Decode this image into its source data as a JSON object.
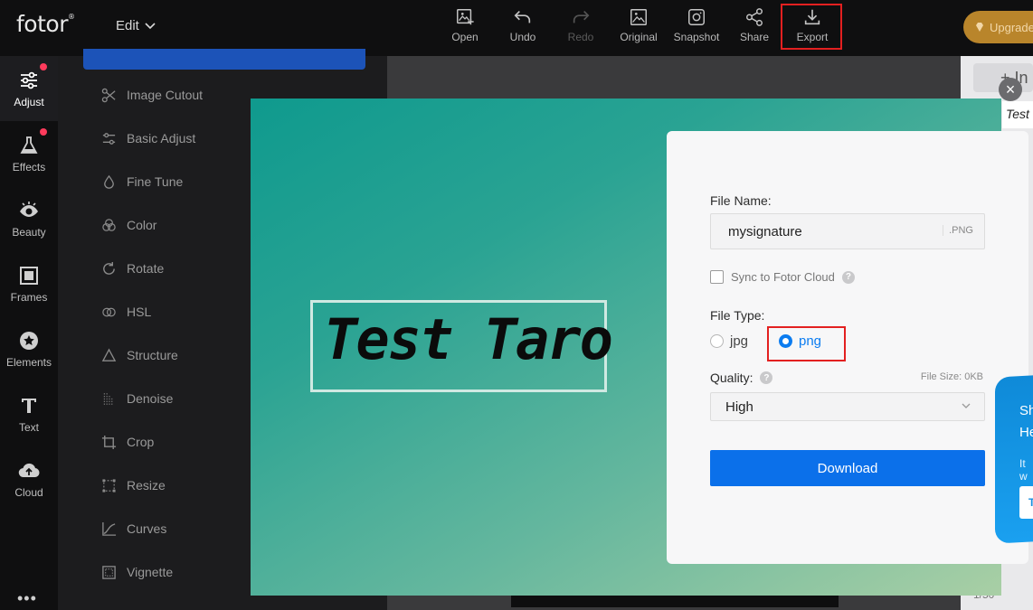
{
  "app": {
    "logo": "fotor",
    "logo_mark": "®",
    "edit_menu": "Edit",
    "upgrade": "Upgrade"
  },
  "toolbar": [
    {
      "name": "open",
      "label": "Open",
      "icon": "image-plus-icon",
      "enabled": true
    },
    {
      "name": "undo",
      "label": "Undo",
      "icon": "undo-icon",
      "enabled": true
    },
    {
      "name": "redo",
      "label": "Redo",
      "icon": "redo-icon",
      "enabled": false
    },
    {
      "name": "original",
      "label": "Original",
      "icon": "image-icon",
      "enabled": true
    },
    {
      "name": "snapshot",
      "label": "Snapshot",
      "icon": "camera-icon",
      "enabled": true
    },
    {
      "name": "share",
      "label": "Share",
      "icon": "share-icon",
      "enabled": true
    },
    {
      "name": "export",
      "label": "Export",
      "icon": "download-icon",
      "enabled": true,
      "highlighted": true
    }
  ],
  "rail": [
    {
      "label": "Adjust",
      "icon": "sliders-icon",
      "active": true,
      "badge": true
    },
    {
      "label": "Effects",
      "icon": "flask-icon",
      "active": false,
      "badge": true
    },
    {
      "label": "Beauty",
      "icon": "eye-icon",
      "active": false,
      "badge": false
    },
    {
      "label": "Frames",
      "icon": "frame-icon",
      "active": false,
      "badge": false
    },
    {
      "label": "Elements",
      "icon": "star-icon",
      "active": false,
      "badge": false
    },
    {
      "label": "Text",
      "icon": "text-icon",
      "active": false,
      "badge": false
    },
    {
      "label": "Cloud",
      "icon": "cloud-upload-icon",
      "active": false,
      "badge": false
    }
  ],
  "rail_more": "•••",
  "panel_items": [
    {
      "label": "Image Cutout",
      "icon": "scissors-icon"
    },
    {
      "label": "Basic Adjust",
      "icon": "sliders-icon"
    },
    {
      "label": "Fine Tune",
      "icon": "droplet-icon"
    },
    {
      "label": "Color",
      "icon": "color-circles-icon"
    },
    {
      "label": "Rotate",
      "icon": "rotate-icon"
    },
    {
      "label": "HSL",
      "icon": "hsl-icon"
    },
    {
      "label": "Structure",
      "icon": "triangle-icon"
    },
    {
      "label": "Denoise",
      "icon": "denoise-icon"
    },
    {
      "label": "Crop",
      "icon": "crop-icon"
    },
    {
      "label": "Resize",
      "icon": "resize-icon"
    },
    {
      "label": "Curves",
      "icon": "curves-icon"
    },
    {
      "label": "Vignette",
      "icon": "vignette-icon"
    }
  ],
  "strip": {
    "add_label": "+ In",
    "thumb_text": "Test",
    "page_count": "1/50"
  },
  "modal": {
    "preview_text": "Test Taro",
    "file_name_label": "File Name:",
    "file_name_value": "mysignature",
    "file_ext": ".PNG",
    "sync_label": "Sync to Fotor Cloud",
    "sync_checked": false,
    "file_type_label": "File Type:",
    "file_types": [
      {
        "label": "jpg",
        "selected": false
      },
      {
        "label": "png",
        "selected": true
      }
    ],
    "quality_label": "Quality:",
    "file_size": "File Size: 0KB",
    "quality_value": "High",
    "download_label": "Download"
  },
  "promo": {
    "line1": "Sh",
    "line2": "He",
    "line3": "It w",
    "button": "T"
  },
  "colors": {
    "accent": "#0b70ea",
    "highlight": "#e32020",
    "badge": "#ff3b5c",
    "upgrade": "#b9852b"
  }
}
